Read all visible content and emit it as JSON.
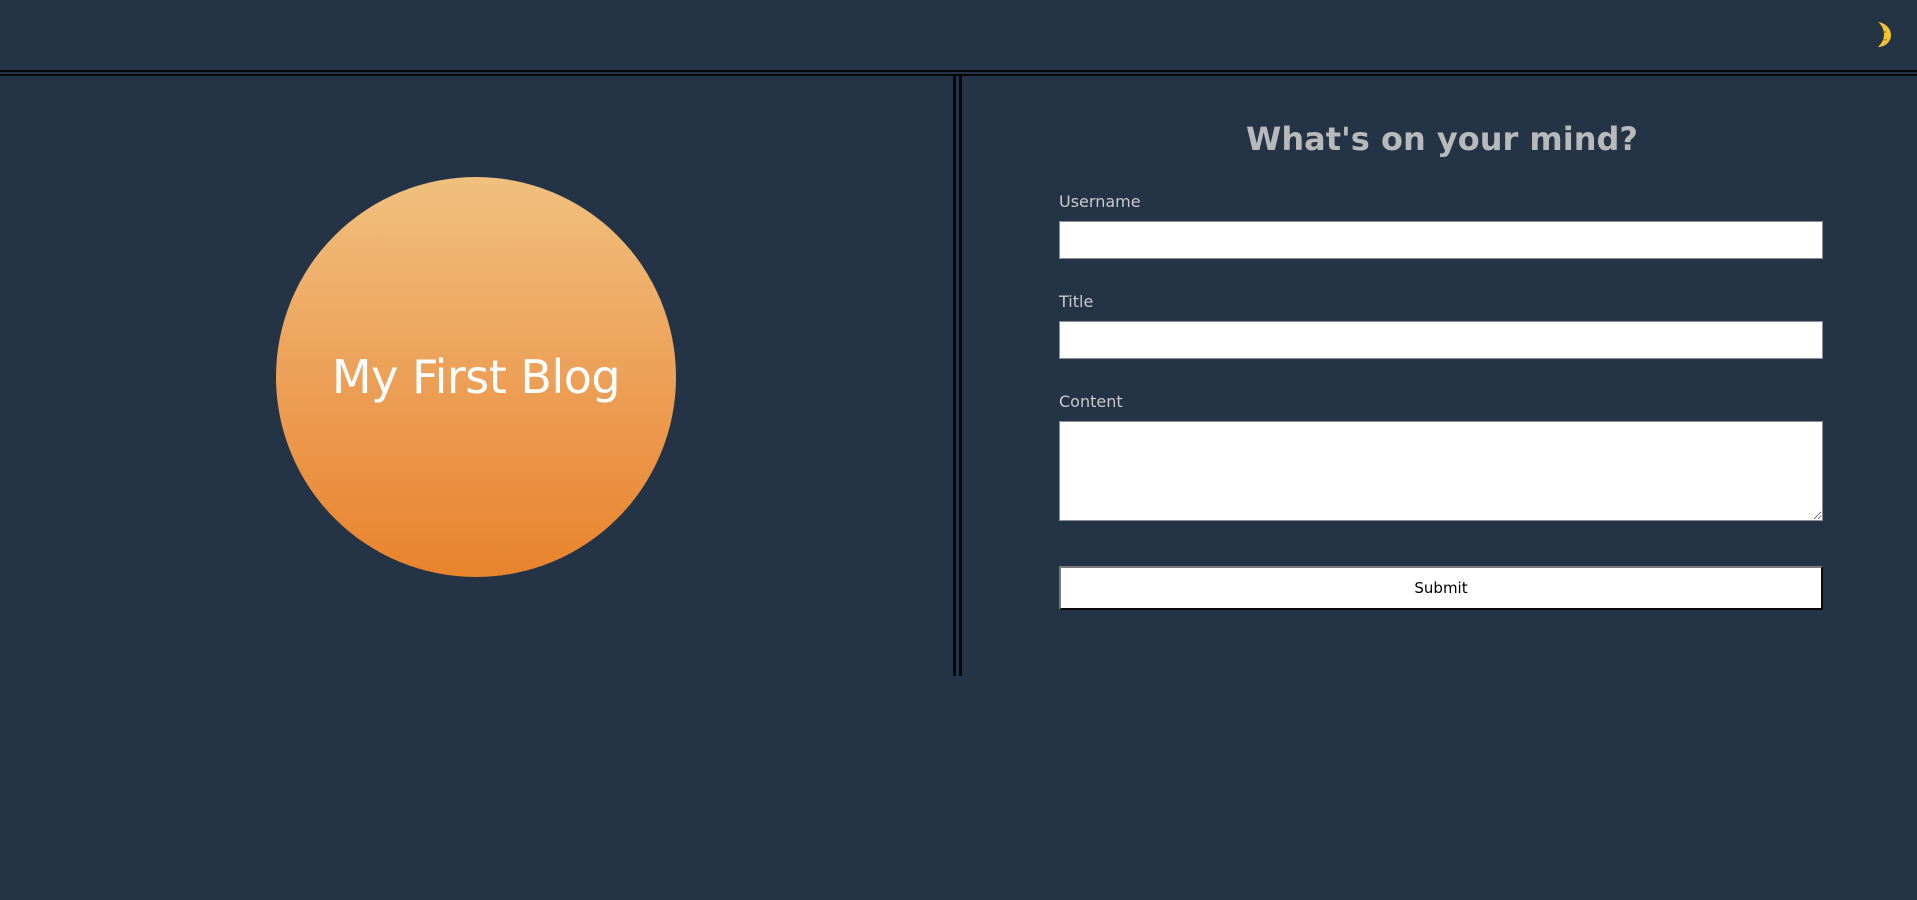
{
  "header": {
    "theme_toggle_icon": "crescent-moon-icon",
    "theme_toggle_color": "#f2c230"
  },
  "logo": {
    "text": "My First Blog",
    "gradient_top": "#f0c07e",
    "gradient_bottom": "#e8832c"
  },
  "form": {
    "title": "What's on your mind?",
    "username_label": "Username",
    "username_value": "",
    "title_label": "Title",
    "title_value": "",
    "content_label": "Content",
    "content_value": "",
    "submit_label": "Submit"
  },
  "colors": {
    "background": "#253347",
    "heading": "#b7b9bb",
    "label": "#c8cacc"
  }
}
